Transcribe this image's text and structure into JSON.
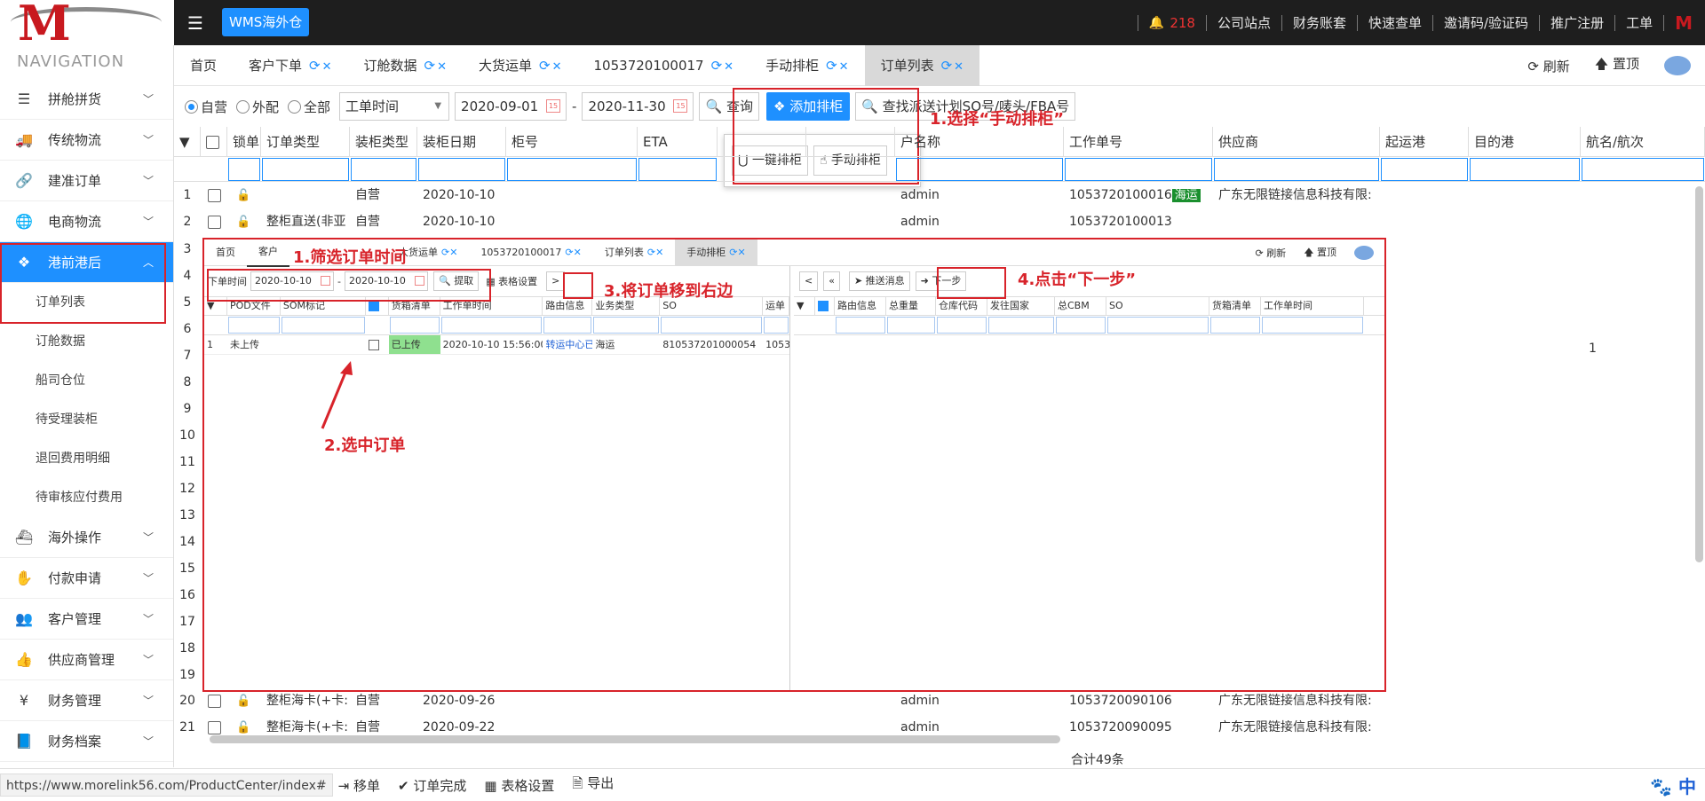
{
  "brand": "WMS海外仓",
  "topnav": {
    "bell_count": "218",
    "items": [
      "公司站点",
      "财务账套",
      "快速查单",
      "邀请码/验证码",
      "推广注册",
      "工单"
    ]
  },
  "sidebar": {
    "title": "NAVIGATION",
    "items": [
      {
        "label": "拼舱拼货",
        "icon": "menu-lines-icon"
      },
      {
        "label": "传统物流",
        "icon": "truck-icon"
      },
      {
        "label": "建准订单",
        "icon": "link-icon"
      },
      {
        "label": "电商物流",
        "icon": "globe-icon"
      },
      {
        "label": "港前港后",
        "icon": "cubes-icon"
      },
      {
        "label": "海外操作",
        "icon": "ship-icon"
      },
      {
        "label": "付款申请",
        "icon": "hand-money-icon"
      },
      {
        "label": "客户管理",
        "icon": "users-icon"
      },
      {
        "label": "供应商管理",
        "icon": "thumbs-up-icon"
      },
      {
        "label": "财务管理",
        "icon": "yen-icon"
      },
      {
        "label": "财务档案",
        "icon": "book-icon"
      }
    ],
    "subitems": [
      "订单列表",
      "订舱数据",
      "船司仓位",
      "待受理装柜",
      "退回费用明细",
      "待审核应付费用"
    ]
  },
  "tabs": [
    "首页",
    "客户下单",
    "订舱数据",
    "大货运单",
    "1053720100017",
    "手动排柜",
    "订单列表"
  ],
  "tabs_right": {
    "refresh": "刷新",
    "top": "置顶"
  },
  "toolbar": {
    "radios": [
      "自营",
      "外配",
      "全部"
    ],
    "time_select": "工单时间",
    "date_from": "2020-09-01",
    "date_to": "2020-11-30",
    "query": "查询",
    "add": "添加排柜",
    "search_placeholder": "查找派送计划SO号/唛头/FBA号"
  },
  "dropdown": {
    "one_key": "一键排柜",
    "manual": "手动排柜"
  },
  "grid": {
    "headers": [
      "锁单",
      "订单类型",
      "装柜类型",
      "装柜日期",
      "柜号",
      "ETA",
      "",
      "",
      "户名称",
      "工作单号",
      "供应商",
      "起运港",
      "目的港",
      "航名/航次"
    ],
    "rows": [
      {
        "n": "1",
        "type": "",
        "load": "自营",
        "date": "2020-10-10",
        "user": "admin",
        "job": "1053720100016",
        "tag": "海运",
        "supplier": "广东无限链接信息科技有限:"
      },
      {
        "n": "2",
        "type": "整柜直送(非亚",
        "load": "自营",
        "date": "2020-10-10",
        "user": "admin",
        "job": "1053720100013",
        "tag": "",
        "supplier": ""
      },
      {
        "n": "20",
        "type": "整柜海卡(+卡:",
        "load": "自营",
        "date": "2020-09-26",
        "user": "admin",
        "job": "1053720090106",
        "tag": "",
        "supplier": "广东无限链接信息科技有限:"
      },
      {
        "n": "21",
        "type": "整柜海卡(+卡:",
        "load": "自营",
        "date": "2020-09-22",
        "user": "admin",
        "job": "1053720090095",
        "tag": "",
        "supplier": "广东无限链接信息科技有限:"
      }
    ],
    "row_numbers": [
      "3",
      "4",
      "5",
      "6",
      "7",
      "8",
      "9",
      "10",
      "11",
      "12",
      "13",
      "14",
      "15",
      "16",
      "17",
      "18",
      "19"
    ],
    "row7_value": "1",
    "total": "合计49条"
  },
  "bottombar": {
    "url": "https://www.morelink56.com/ProductCenter/index#",
    "items": [
      "移单",
      "订单完成",
      "表格设置",
      "导出"
    ],
    "ime": "中"
  },
  "overlay": {
    "tabs": [
      "首页",
      "客户",
      "大货运单",
      "1053720100017",
      "订单列表",
      "手动排柜"
    ],
    "refresh": "刷新",
    "top": "置顶",
    "left": {
      "label": "下单时间",
      "date_from": "2020-10-10",
      "date_to": "2020-10-10",
      "fetch": "提取",
      "grid_settings": "表格设置",
      "move": ">",
      "headers": [
        "POD文件",
        "SOM标记",
        "货箱清单",
        "工作单时间",
        "路由信息",
        "业务类型",
        "SO",
        "运单"
      ],
      "row": {
        "n": "1",
        "pod": "未上传",
        "box": "已上传",
        "time": "2020-10-10 15:56:00",
        "route": "转运中心已",
        "biz": "海运",
        "so": "810537201000054",
        "waybill": "1053"
      }
    },
    "right": {
      "prev": "<",
      "first": "«",
      "push": "推送消息",
      "next": "下一步",
      "headers": [
        "路由信息",
        "总重量",
        "仓库代码",
        "发往国家",
        "总CBM",
        "SO",
        "货箱清单",
        "工作单时间"
      ]
    }
  },
  "annotations": {
    "a1": "1.选择“手动排柜”",
    "a2": "1.筛选订单时间",
    "a3": "2.选中订单",
    "a4": "3.将订单移到右边",
    "a5": "4.点击“下一步”"
  }
}
